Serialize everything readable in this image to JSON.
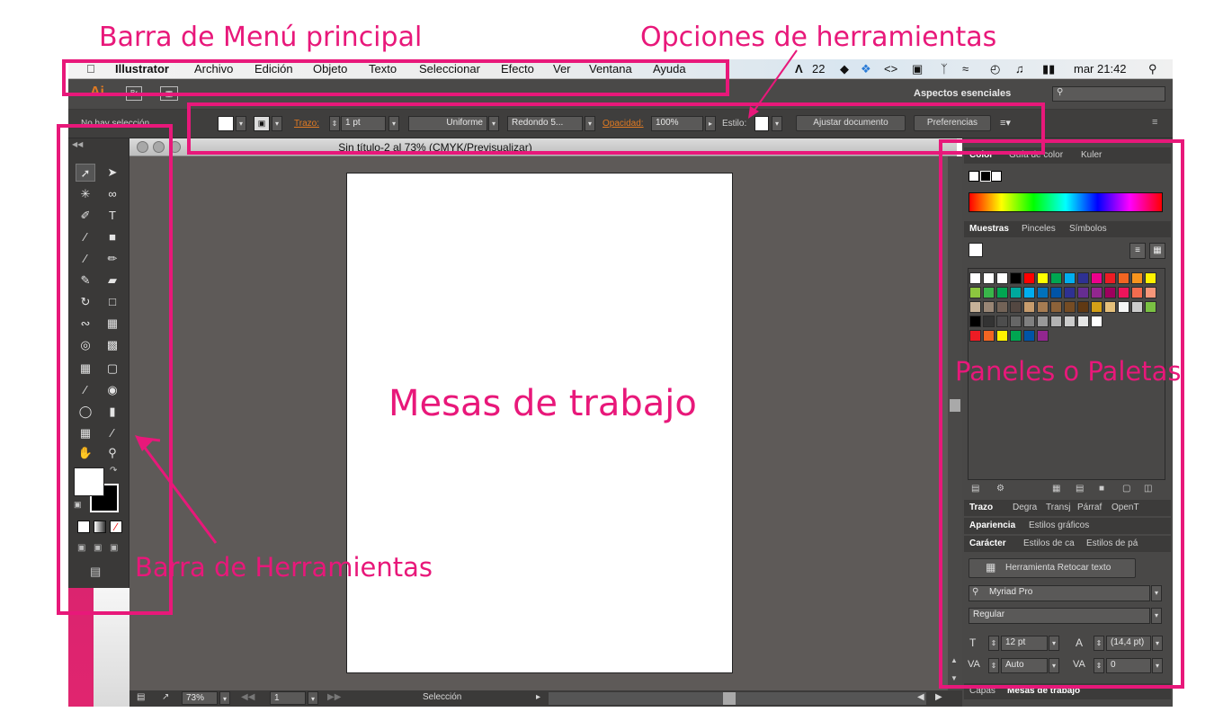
{
  "annotations": {
    "menu_bar": "Barra de Menú principal",
    "tool_options": "Opciones de herramientas",
    "artboards": "Mesas de trabajo",
    "panels": "Paneles o Paletas",
    "toolbar": "Barra de Herramientas"
  },
  "menubar": {
    "app": "Illustrator",
    "items": [
      "Archivo",
      "Edición",
      "Objeto",
      "Texto",
      "Seleccionar",
      "Efecto",
      "Ver",
      "Ventana",
      "Ayuda"
    ],
    "status_num": "22",
    "clock": "mar 21:42"
  },
  "appbar": {
    "logo": "Ai",
    "br_label": "Br",
    "workspace": "Aspectos esenciales"
  },
  "controlbar": {
    "selection": "No hay selección",
    "stroke_label": "Trazo:",
    "stroke_value": "1 pt",
    "stroke_profile": "Uniforme",
    "brush": "Redondo 5...",
    "opacity_label": "Opacidad:",
    "opacity_value": "100%",
    "style_label": "Estilo:",
    "fit_document": "Ajustar documento",
    "preferences": "Preferencias"
  },
  "document": {
    "title": "Sin título-2 al 73% (CMYK/Previsualizar)"
  },
  "statusbar": {
    "zoom": "73%",
    "page": "1",
    "tool": "Selección"
  },
  "panels": {
    "color_tabs": [
      "Color",
      "Guía de color",
      "Kuler"
    ],
    "swatch_tabs": [
      "Muestras",
      "Pinceles",
      "Símbolos"
    ],
    "stroke_tabs": [
      "Trazo",
      "Degra",
      "Transj",
      "Párraf",
      "OpenT"
    ],
    "appearance_tabs": [
      "Apariencia",
      "Estilos gráficos"
    ],
    "char_tabs": [
      "Carácter",
      "Estilos de ca",
      "Estilos de pá"
    ],
    "touch_type": "Herramienta Retocar texto",
    "font_family": "Myriad Pro",
    "font_style": "Regular",
    "font_size": "12 pt",
    "leading": "(14,4 pt)",
    "kerning": "Auto",
    "tracking": "0",
    "bottom_tabs": [
      "Capas",
      "Mesas de trabajo"
    ]
  },
  "colors": {
    "annotation": "#e8187a",
    "accent_orange": "#e07a22"
  }
}
